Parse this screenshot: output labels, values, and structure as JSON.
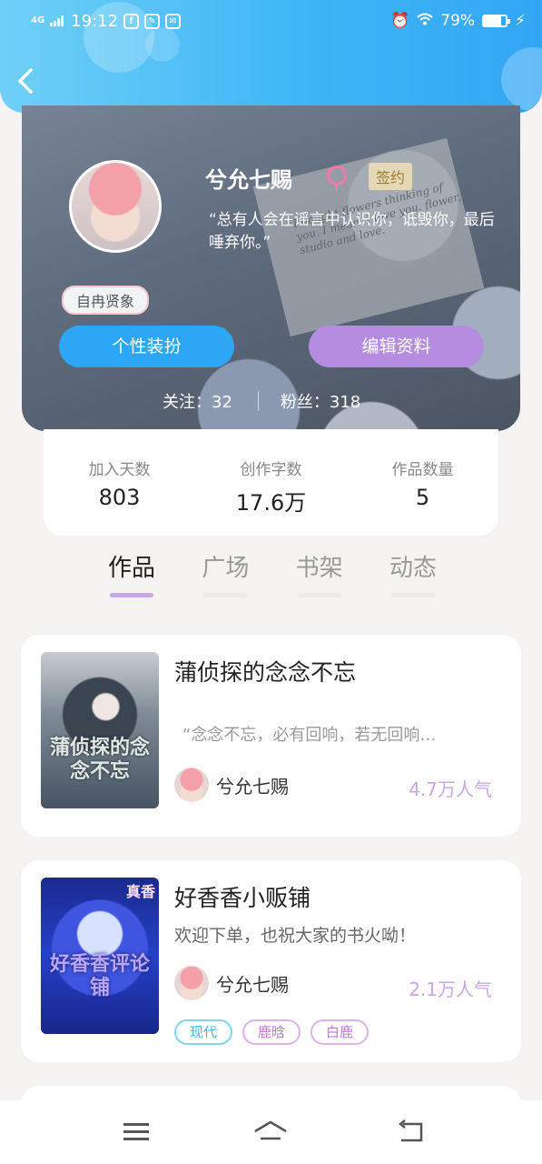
{
  "status_bar": {
    "network": "4G",
    "time": "19:12",
    "app_icons": [
      "f",
      "leaf",
      "mail"
    ],
    "battery_percent": "79%",
    "battery_level": 0.79
  },
  "profile": {
    "username": "兮允七赐",
    "sign_badge": "签约",
    "bio": "“总有人会在谣言中认识你，诋毁你，最后唾弃你。”",
    "title_badge": "自冉贤象",
    "dress_button": "个性装扮",
    "edit_button": "编辑资料",
    "following_label": "关注：",
    "following": "32",
    "fans_label": "粉丝：",
    "fans": "318",
    "banner_script": "I bought flowers thinking of you. I mean, I love you. flower, studio and love."
  },
  "stats": [
    {
      "label": "加入天数",
      "value": "803"
    },
    {
      "label": "创作字数",
      "value": "17.6万"
    },
    {
      "label": "作品数量",
      "value": "5"
    }
  ],
  "tabs": [
    {
      "label": "作品",
      "active": true
    },
    {
      "label": "广场",
      "active": false
    },
    {
      "label": "书架",
      "active": false
    },
    {
      "label": "动态",
      "active": false
    }
  ],
  "works": [
    {
      "title": "蒲侦探的念念不忘",
      "quote": "“念念不忘，必有回响，若无回响…",
      "cover_text": "蒲侦探的念念不忘",
      "author": "兮允七赐",
      "popularity": "4.7万人气"
    },
    {
      "title": "好香香小贩铺",
      "desc": "欢迎下单，也祝大家的书火呦！",
      "cover_text": "好香香评论铺",
      "cover_tag": "真香",
      "author": "兮允七赐",
      "popularity": "2.1万人气",
      "tags": [
        "现代",
        "鹿晗",
        "白鹿"
      ]
    }
  ],
  "colors": {
    "header_gradient": [
      "#6fd0f6",
      "#33a6f3"
    ],
    "dress_button": "#2ba7f5",
    "edit_button": "#b48ce0",
    "popularity": "#c9a6e8",
    "tab_active_underline": "#c7a8e6"
  }
}
